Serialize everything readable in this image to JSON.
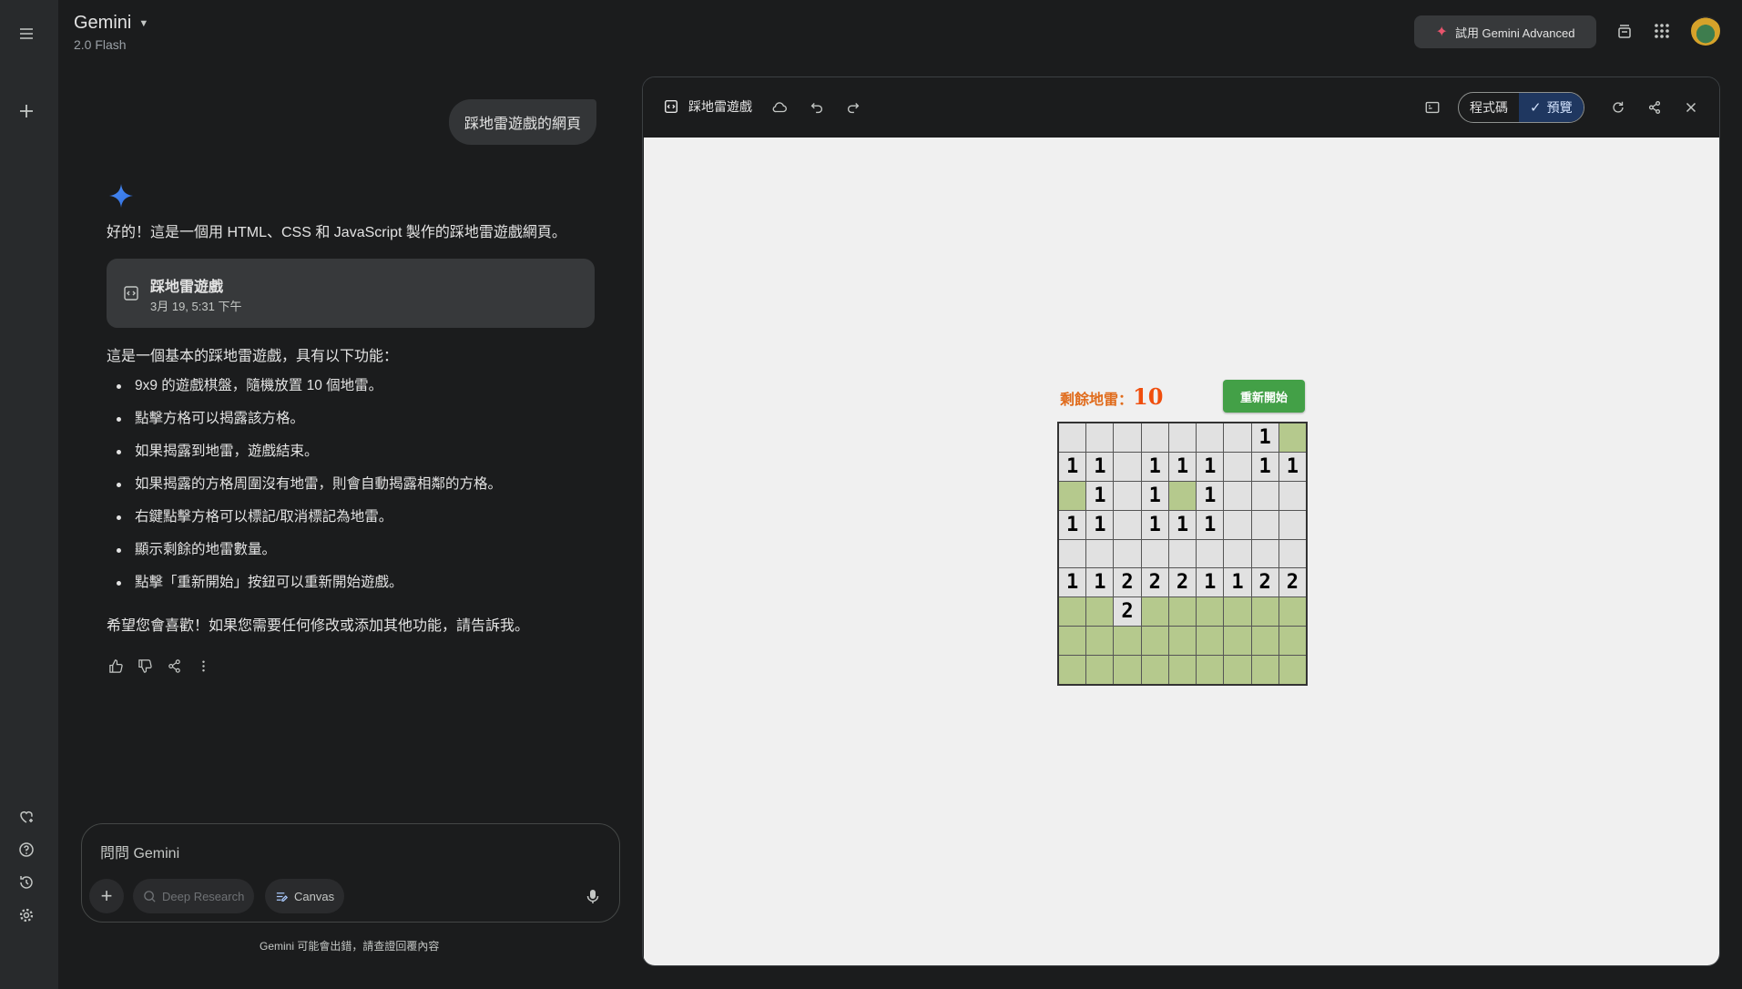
{
  "app": {
    "title": "Gemini",
    "model": "2.0 Flash",
    "try_advanced": "試用 Gemini Advanced"
  },
  "chat": {
    "user_prompt": "踩地雷遊戲的網頁",
    "reply_intro": "好的！這是一個用 HTML、CSS 和 JavaScript 製作的踩地雷遊戲網頁。",
    "artifact": {
      "name": "踩地雷遊戲",
      "date": "3月 19, 5:31 下午"
    },
    "intro2": "這是一個基本的踩地雷遊戲，具有以下功能：",
    "features": [
      "9x9 的遊戲棋盤，隨機放置 10 個地雷。",
      "點擊方格可以揭露該方格。",
      "如果揭露到地雷，遊戲結束。",
      "如果揭露的方格周圍沒有地雷，則會自動揭露相鄰的方格。",
      "右鍵點擊方格可以標記/取消標記為地雷。",
      "顯示剩餘的地雷數量。",
      "點擊「重新開始」按鈕可以重新開始遊戲。"
    ],
    "closing": "希望您會喜歡！如果您需要任何修改或添加其他功能，請告訴我。"
  },
  "input": {
    "placeholder": "問問 Gemini",
    "deep_research": "Deep Research",
    "canvas": "Canvas",
    "disclaimer": "Gemini 可能會出錯，請查證回覆內容"
  },
  "panel": {
    "title": "踩地雷遊戲",
    "code_tab": "程式碼",
    "preview_tab": "預覽"
  },
  "game": {
    "counter_label": "剩餘地雷：",
    "counter_value": "10",
    "restart": "重新開始",
    "board": [
      [
        "r",
        "r",
        "r",
        "r",
        "r",
        "r",
        "r",
        "1",
        "g"
      ],
      [
        "1",
        "1",
        "r",
        "1",
        "1",
        "1",
        "r",
        "1",
        "1"
      ],
      [
        "g",
        "1",
        "r",
        "1",
        "g",
        "1",
        "r",
        "r",
        "r"
      ],
      [
        "1",
        "1",
        "r",
        "1",
        "1",
        "1",
        "r",
        "r",
        "r"
      ],
      [
        "r",
        "r",
        "r",
        "r",
        "r",
        "r",
        "r",
        "r",
        "r"
      ],
      [
        "1",
        "1",
        "2",
        "2",
        "2",
        "1",
        "1",
        "2",
        "2"
      ],
      [
        "g",
        "g",
        "2",
        "g",
        "g",
        "g",
        "g",
        "g",
        "g"
      ],
      [
        "g",
        "g",
        "g",
        "g",
        "g",
        "g",
        "g",
        "g",
        "g"
      ],
      [
        "g",
        "g",
        "g",
        "g",
        "g",
        "g",
        "g",
        "g",
        "g"
      ]
    ]
  },
  "colors": {
    "accent_blue": "#4b8cf5",
    "board_unrevealed": "#b5c98d",
    "board_revealed": "#e1e1e1",
    "restart_green": "#43a047"
  }
}
